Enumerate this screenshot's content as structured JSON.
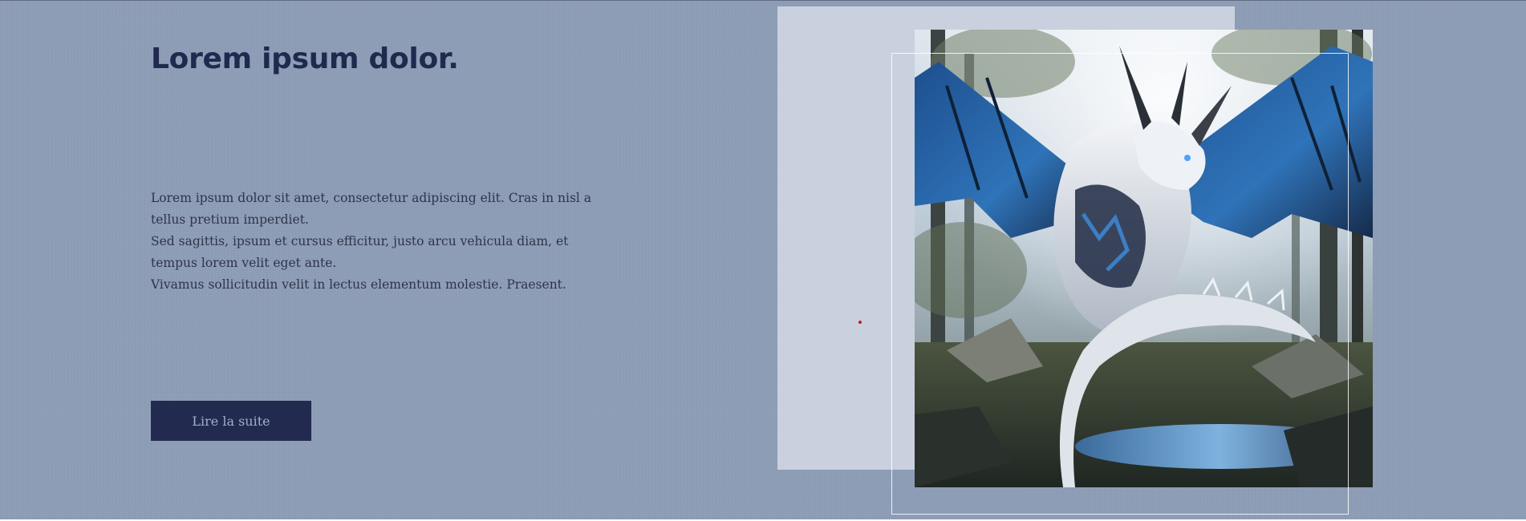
{
  "hero": {
    "title": "Lorem ipsum dolor.",
    "paragraphs": [
      "Lorem ipsum dolor sit amet, consectetur adipiscing elit. Cras in nisl a tellus pretium imperdiet.",
      "Sed sagittis, ipsum et cursus efficitur, justo arcu vehicula diam, et tempus lorem velit eget ante.",
      "Vivamus sollicitudin velit in lectus elementum molestie. Praesent."
    ],
    "cta_label": "Lire la suite"
  },
  "media": {
    "image_subject": "white-and-blue-dragon-in-forest-illustration"
  },
  "colors": {
    "background": "#8d9db6",
    "heading": "#202a4e",
    "body_text": "#2e3448",
    "button_bg": "#222a4f",
    "button_text": "#9fb0cc",
    "panel": "#c9d1de",
    "frame_outline": "#ffffff",
    "marker": "#d0181f"
  }
}
